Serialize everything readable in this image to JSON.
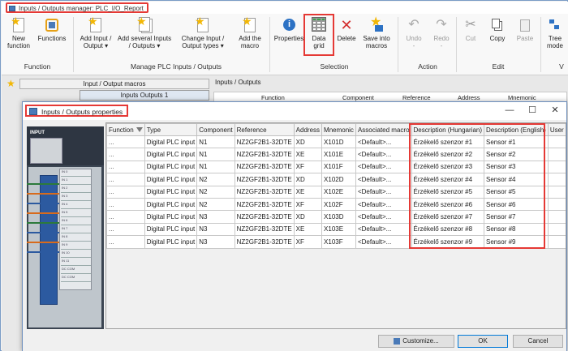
{
  "window": {
    "title": "Inputs / Outputs manager: PLC_I/O_Report"
  },
  "ribbon": {
    "groups": [
      {
        "label": "Function",
        "buttons": [
          {
            "label": "New function"
          },
          {
            "label": "Functions"
          }
        ]
      },
      {
        "label": "Manage PLC Inputs / Outputs",
        "buttons": [
          {
            "label": "Add Input / Output"
          },
          {
            "label": "Add several Inputs / Outputs"
          },
          {
            "label": "Change Input / Output types"
          },
          {
            "label": "Add the macro"
          }
        ]
      },
      {
        "label": "Selection",
        "buttons": [
          {
            "label": "Properties"
          },
          {
            "label": "Data grid"
          },
          {
            "label": "Delete"
          },
          {
            "label": "Save into macros"
          }
        ]
      },
      {
        "label": "Action",
        "buttons": [
          {
            "label": "Undo"
          },
          {
            "label": "Redo"
          }
        ]
      },
      {
        "label": "Edit",
        "buttons": [
          {
            "label": "Cut"
          },
          {
            "label": "Copy"
          },
          {
            "label": "Paste"
          }
        ]
      },
      {
        "label": "V",
        "buttons": [
          {
            "label": "Tree mode"
          }
        ]
      }
    ]
  },
  "left_panel": {
    "macros_header": "Input / Output macros",
    "tab": "Inputs Outputs 1"
  },
  "right_panel": {
    "title": "Inputs / Outputs",
    "columns": [
      "Function",
      "Component",
      "Reference",
      "Address",
      "Mnemonic"
    ]
  },
  "dialog": {
    "title": "Inputs / Outputs properties",
    "controls": {
      "minimize": "—",
      "maximize": "☐",
      "close": "✕"
    },
    "picture": {
      "label": "INPUT",
      "terminals": [
        "IN 0",
        "IN 1",
        "IN 2",
        "IN 3",
        "IN 4",
        "IN 5",
        "IN 6",
        "IN 7",
        "IN 8",
        "IN 9",
        "IN 10",
        "IN 11",
        "DC COM",
        "DC COM"
      ]
    },
    "grid": {
      "headers": [
        "Function",
        "Type",
        "Component",
        "Reference",
        "Address",
        "Mnemonic",
        "Associated macro",
        "Description (Hungarian)",
        "Description (English)",
        "User d"
      ],
      "rows": [
        [
          "...",
          "Digital PLC input",
          "N1",
          "NZ2GF2B1-32DTE",
          "XD",
          "X101D",
          "<Default>...",
          "Érzékelő szenzor #1",
          "Sensor #1",
          ""
        ],
        [
          "...",
          "Digital PLC input",
          "N1",
          "NZ2GF2B1-32DTE",
          "XE",
          "X101E",
          "<Default>...",
          "Érzékelő szenzor #2",
          "Sensor #2",
          ""
        ],
        [
          "...",
          "Digital PLC input",
          "N1",
          "NZ2GF2B1-32DTE",
          "XF",
          "X101F",
          "<Default>...",
          "Érzékelő szenzor #3",
          "Sensor #3",
          ""
        ],
        [
          "...",
          "Digital PLC input",
          "N2",
          "NZ2GF2B1-32DTE",
          "XD",
          "X102D",
          "<Default>...",
          "Érzékelő szenzor #4",
          "Sensor #4",
          ""
        ],
        [
          "...",
          "Digital PLC input",
          "N2",
          "NZ2GF2B1-32DTE",
          "XE",
          "X102E",
          "<Default>...",
          "Érzékelő szenzor #5",
          "Sensor #5",
          ""
        ],
        [
          "...",
          "Digital PLC input",
          "N2",
          "NZ2GF2B1-32DTE",
          "XF",
          "X102F",
          "<Default>...",
          "Érzékelő szenzor #6",
          "Sensor #6",
          ""
        ],
        [
          "...",
          "Digital PLC input",
          "N3",
          "NZ2GF2B1-32DTE",
          "XD",
          "X103D",
          "<Default>...",
          "Érzékelő szenzor #7",
          "Sensor #7",
          ""
        ],
        [
          "...",
          "Digital PLC input",
          "N3",
          "NZ2GF2B1-32DTE",
          "XE",
          "X103E",
          "<Default>...",
          "Érzékelő szenzor #8",
          "Sensor #8",
          ""
        ],
        [
          "...",
          "Digital PLC input",
          "N3",
          "NZ2GF2B1-32DTE",
          "XF",
          "X103F",
          "<Default>...",
          "Érzékelő szenzor #9",
          "Sensor #9",
          ""
        ]
      ]
    },
    "buttons": {
      "customize": "Customize...",
      "ok": "OK",
      "cancel": "Cancel"
    }
  },
  "colors": {
    "highlight": "#e53935",
    "accent": "#0078d7"
  }
}
